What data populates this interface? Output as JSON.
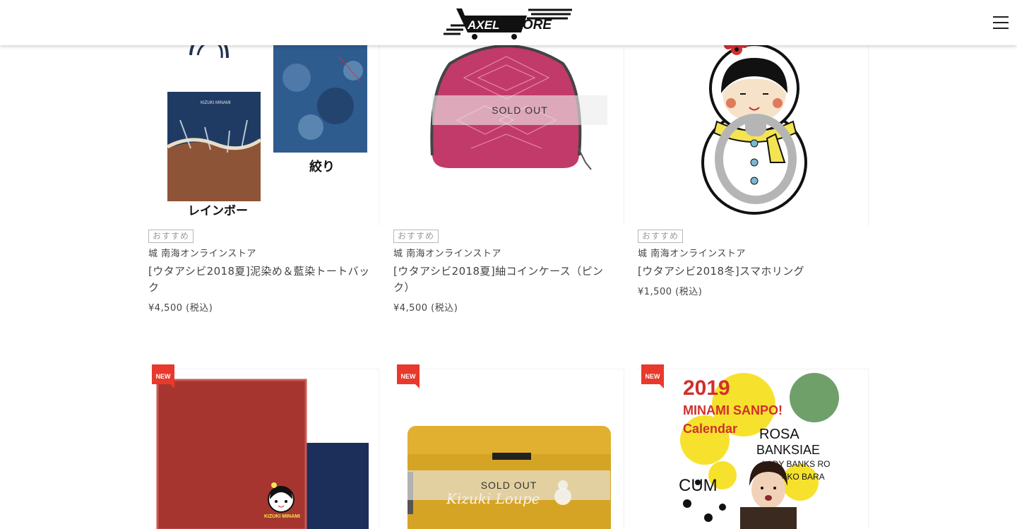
{
  "header": {
    "logo_text": "AXEL STORE",
    "menu_icon": "hamburger-icon"
  },
  "products": [
    {
      "badge": "おすすめ",
      "store": "城 南海オンラインストア",
      "title": "[ウタアシビ2018夏]泥染め＆藍染トートバック",
      "price": "¥4,500",
      "tax": "(税込)",
      "image_label_1": "レインボー",
      "image_label_2": "絞り",
      "bag_text": "KIZUKI MINAMI",
      "sold_out": ""
    },
    {
      "badge": "おすすめ",
      "store": "城 南海オンラインストア",
      "title": "[ウタアシビ2018夏]紬コインケース（ピンク）",
      "price": "¥4,500",
      "tax": "(税込)",
      "sold_out": "SOLD OUT"
    },
    {
      "badge": "おすすめ",
      "store": "城 南海オンラインストア",
      "title": "[ウタアシビ2018冬]スマホリング",
      "price": "¥1,500",
      "tax": "(税込)",
      "sold_out": ""
    },
    {
      "new_label": "NEW",
      "image_text": "KIZUKI MINAMI",
      "sold_out": ""
    },
    {
      "new_label": "NEW",
      "image_text": "Kizuki Loupe",
      "sold_out": "SOLD OUT"
    },
    {
      "new_label": "NEW",
      "calendar_year": "2019",
      "calendar_title": "MINAMI SANPO!",
      "calendar_sub": "Calendar",
      "calendar_text_1": "ROSA",
      "calendar_text_2": "BANKSIAE",
      "calendar_text_3": "LADY BANKS RO",
      "calendar_text_4": "MOKKO BARA",
      "calendar_text_5": "CUM",
      "sold_out": ""
    }
  ],
  "colors": {
    "new_flag": "#e8392c",
    "badge_border": "#b8b8b8",
    "text": "#444444"
  }
}
